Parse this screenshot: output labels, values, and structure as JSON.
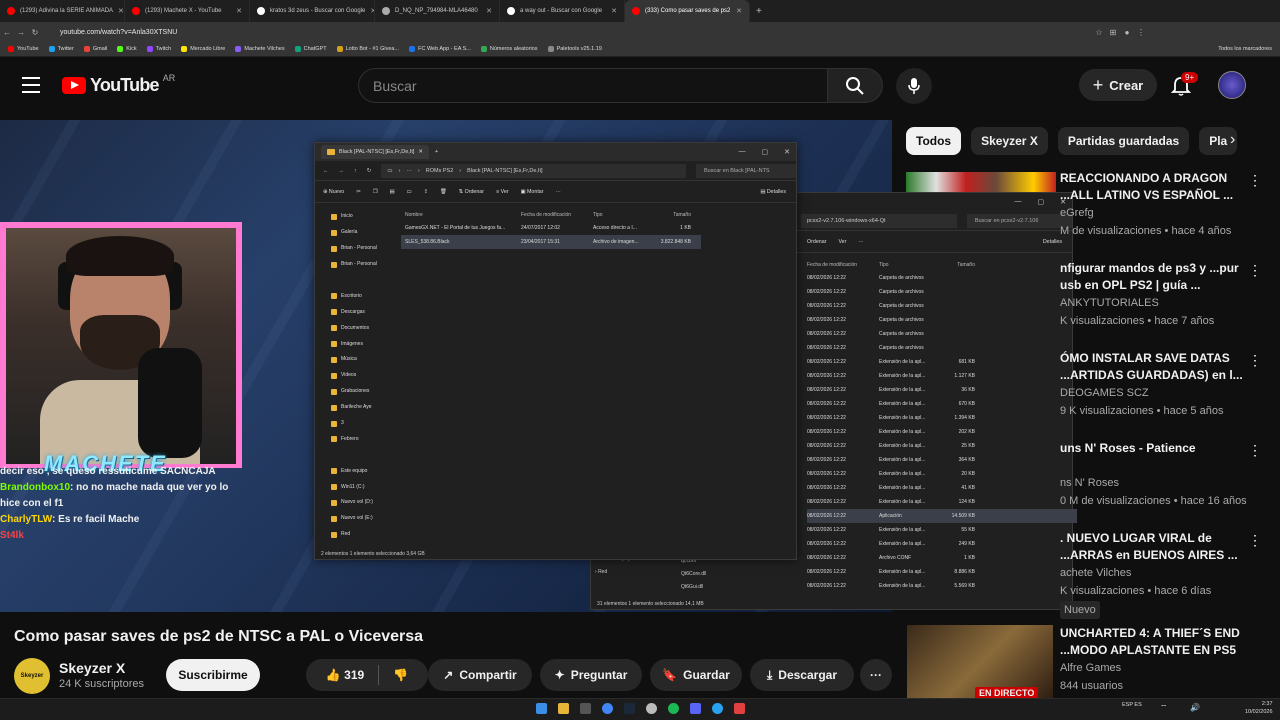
{
  "browser": {
    "tabs": [
      {
        "label": "(1293) Adivina la SERIE ANIMADA",
        "color": "#ff0000",
        "active": false
      },
      {
        "label": "(1293) Machete X - YouTube",
        "color": "#ff0000",
        "active": false
      },
      {
        "label": "kratos 3d zeus - Buscar con Google",
        "color": "#ffffff",
        "active": false
      },
      {
        "label": "D_NQ_NP_794984-MLA46480",
        "color": "#aaaaaa",
        "active": false
      },
      {
        "label": "a way out - Buscar con Google",
        "color": "#ffffff",
        "active": false
      },
      {
        "label": "(333) Como pasar saves de ps2",
        "color": "#ff0000",
        "active": true
      }
    ],
    "url": "youtube.com/watch?v=Anla30XTSNU",
    "bookmarks": [
      "YouTube",
      "Twitter",
      "Gmail",
      "Kick",
      "Twitch",
      "Mercado Libre",
      "Machete Vilches",
      "ChatGPT",
      "Lotto Bot - #1 Givea...",
      "FC Web App - EA S...",
      "Números aleatorios",
      "Paletools v25.1.19"
    ],
    "bookmarks_right": "Todos los marcadores"
  },
  "youtube": {
    "logo": "YouTube",
    "region": "AR",
    "search_placeholder": "Buscar",
    "create_label": "Crear",
    "notif_badge": "9+"
  },
  "explorer1": {
    "tab": "Black [PAL-NTSC] [Es,Fr,De,It]",
    "crumb1": "ROMs PS2",
    "crumb2": "Black [PAL-NTSC] [Es,Fr,De,It]",
    "search": "Buscar en Black [PAL-NTS",
    "tools": [
      "Nuevo",
      "Ordenar",
      "Ver",
      "Montar",
      "Detalles"
    ],
    "sidebar": [
      "Inicio",
      "Galería",
      "Brian - Personal",
      "Brian - Personal",
      "Escritorio",
      "Descargas",
      "Documentos",
      "Imágenes",
      "Música",
      "Videos",
      "Grabaciones",
      "Barileche Aye",
      "3",
      "Febrero",
      "Este equipo",
      "Win11 (C:)",
      "Nuevo vol (D:)",
      "Nuevo vol (E:)",
      "Red"
    ],
    "headers": [
      "Nombre",
      "Fecha de modificación",
      "Tipo",
      "Tamaño"
    ],
    "files": [
      {
        "name": "GamesGX.NET - El Portal de tus Juegos fa...",
        "date": "24/07/2017 12:02",
        "type": "Acceso directo a I...",
        "size": "1 KB"
      },
      {
        "name": "SLES_538.86.Black",
        "date": "23/04/2017 15:31",
        "type": "Archivo de imagen...",
        "size": "3.822.848 KB"
      }
    ],
    "status": "2 elementos   1 elemento seleccionado 3,64 GB"
  },
  "explorer2": {
    "crumb": "pcsx2-v2.7.106-windows-x64-Qt",
    "search": "Buscar en pcsx2-v2.7.106",
    "tools": [
      "Ordenar",
      "Ver",
      "Detalles"
    ],
    "headers": [
      "Fecha de modificación",
      "Tipo",
      "Tamaño"
    ],
    "rows": [
      {
        "date": "08/02/2026 12:22",
        "type": "Carpeta de archivos",
        "size": ""
      },
      {
        "date": "08/02/2026 12:22",
        "type": "Carpeta de archivos",
        "size": ""
      },
      {
        "date": "08/02/2026 12:22",
        "type": "Carpeta de archivos",
        "size": ""
      },
      {
        "date": "08/02/2026 12:22",
        "type": "Carpeta de archivos",
        "size": ""
      },
      {
        "date": "08/02/2026 12:22",
        "type": "Carpeta de archivos",
        "size": ""
      },
      {
        "date": "08/02/2026 12:22",
        "type": "Carpeta de archivos",
        "size": ""
      },
      {
        "date": "08/02/2026 12:22",
        "type": "Extensión de la apl...",
        "size": "681 KB"
      },
      {
        "date": "08/02/2026 12:22",
        "type": "Extensión de la apl...",
        "size": "1.127 KB"
      },
      {
        "date": "08/02/2026 12:22",
        "type": "Extensión de la apl...",
        "size": "36 KB"
      },
      {
        "date": "08/02/2026 12:22",
        "type": "Extensión de la apl...",
        "size": "670 KB"
      },
      {
        "date": "08/02/2026 12:22",
        "type": "Extensión de la apl...",
        "size": "1.394 KB"
      },
      {
        "date": "08/02/2026 12:22",
        "type": "Extensión de la apl...",
        "size": "202 KB"
      },
      {
        "date": "08/02/2026 12:22",
        "type": "Extensión de la apl...",
        "size": "25 KB"
      },
      {
        "date": "08/02/2026 12:22",
        "type": "Extensión de la apl...",
        "size": "364 KB"
      },
      {
        "date": "08/02/2026 12:22",
        "type": "Extensión de la apl...",
        "size": "20 KB"
      },
      {
        "date": "08/02/2026 12:22",
        "type": "Extensión de la apl...",
        "size": "41 KB"
      },
      {
        "date": "08/02/2026 12:22",
        "type": "Extensión de la apl...",
        "size": "124 KB"
      },
      {
        "date": "08/02/2026 12:22",
        "type": "Aplicación",
        "size": "14.509 KB"
      },
      {
        "date": "08/02/2026 12:22",
        "type": "Extensión de la apl...",
        "size": "55 KB"
      },
      {
        "date": "08/02/2026 12:22",
        "type": "Extensión de la apl...",
        "size": "249 KB"
      },
      {
        "date": "08/02/2026 12:22",
        "type": "Archivo CONF",
        "size": "1 KB"
      },
      {
        "date": "08/02/2026 12:22",
        "type": "Extensión de la apl...",
        "size": "8.886 KB"
      },
      {
        "date": "08/02/2026 12:22",
        "type": "Extensión de la apl...",
        "size": "5.569 KB"
      }
    ],
    "side_bottom": [
      "Nuevo vol (E:)",
      "Red"
    ],
    "left_files": [
      "qt.conf",
      "Qt6Core.dll",
      "Qt6Gui.dll"
    ],
    "status": "31 elementos   1 elemento seleccionado 14,1 MB"
  },
  "stream": {
    "overlay_name": "MACHETE",
    "chat": [
      {
        "user": "",
        "msg": "decir eso , se queso ressuticume SACNCAJA",
        "color": "#ffffff"
      },
      {
        "user": "Brandonbox10",
        "msg": ": no no mache nada que ver yo lo",
        "color": "#7cfc00"
      },
      {
        "user": "",
        "msg": "hice con el f1",
        "color": "#ffffff"
      },
      {
        "user": "CharlyTLW",
        "msg": ": Es re facil Mache",
        "color": "#ffd700"
      },
      {
        "user": "St4lk",
        "msg": "",
        "color": "#ff4040"
      }
    ]
  },
  "video": {
    "title": "Como pasar saves de ps2 de NTSC a PAL o Viceversa",
    "channel": "Skeyzer X",
    "channel_avatar_text": "Skeyzer",
    "subscribers": "24 K suscriptores",
    "subscribe_label": "Suscribirme",
    "likes": "319",
    "share_label": "Compartir",
    "ask_label": "Preguntar",
    "save_label": "Guardar",
    "download_label": "Descargar"
  },
  "chips": [
    "Todos",
    "Skeyzer X",
    "Partidas guardadas",
    "Pla"
  ],
  "recommendations": [
    {
      "title": "REACCIONANDO A DRAGON ...ALL LATINO VS ESPAÑOL ...",
      "channel": "eGrefg",
      "meta": "M de visualizaciones • hace 4 años"
    },
    {
      "title": "nfigurar mandos de ps3 y ...pur usb en OPL PS2 | guía ...",
      "channel": "ANKYTUTORIALES",
      "meta": "K visualizaciones • hace 7 años"
    },
    {
      "title": "ÓMO INSTALAR SAVE DATAS ...ARTIDAS GUARDADAS) en l...",
      "channel": "DEOGAMES SCZ",
      "meta": "9 K visualizaciones • hace 5 años"
    },
    {
      "title": "uns N' Roses - Patience",
      "channel": "ns N' Roses",
      "meta": "0 M de visualizaciones • hace 16 años"
    },
    {
      "title": ". NUEVO LUGAR VIRAL de ...ARRAS en BUENOS AIRES ...",
      "channel": "achete Vilches",
      "meta": "K visualizaciones • hace 6 días",
      "badge": "Nuevo"
    },
    {
      "title": "UNCHARTED 4: A THIEF´S END ...MODO APLASTANTE EN PS5",
      "channel": "Alfre Games",
      "meta": "844 usuarios",
      "live": "EN DIRECTO"
    }
  ],
  "taskbar": {
    "lang": "ESP ES",
    "time": "2:37",
    "date": "10/02/2026"
  }
}
